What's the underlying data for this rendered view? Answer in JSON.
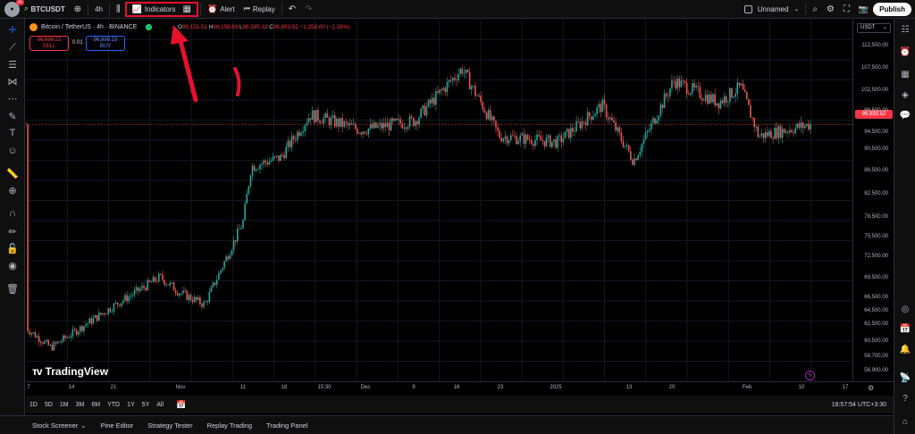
{
  "topbar": {
    "avatar_badge": "11",
    "symbol": "BTCUSDT",
    "interval": "4h",
    "indicators_label": "Indicators",
    "alert_label": "Alert",
    "replay_label": "Replay",
    "layout_name": "Unnamed",
    "publish_label": "Publish"
  },
  "legend": {
    "title": "Bitcoin / TetherUS · 4h · BINANCE",
    "o": "98,151.51",
    "h": "98,158.89",
    "l": "96,595.33",
    "c": "96,893.52",
    "change": "−1,258.00 (−1.28%)",
    "sell_price": "96,899.22",
    "sell_label": "SELL",
    "spread": "0.01",
    "buy_price": "96,899.23",
    "buy_label": "BUY"
  },
  "price_axis": {
    "currency": "USDT",
    "current_price": "96,893.52",
    "labels": [
      "112,500.00",
      "107,500.00",
      "102,500.00",
      "98,500.00",
      "94,500.00",
      "90,500.00",
      "86,500.00",
      "82,500.00",
      "78,500.00",
      "75,500.00",
      "72,500.00",
      "69,500.00",
      "66,500.00",
      "64,500.00",
      "62,500.00",
      "60,500.00",
      "58,700.00",
      "56,900.00"
    ]
  },
  "time_axis": {
    "labels": [
      "7",
      "14",
      "21",
      "Nov",
      "11",
      "18",
      "15:30",
      "Dec",
      "9",
      "16",
      "23",
      "2025",
      "13",
      "20",
      "Feb",
      "10",
      "17"
    ]
  },
  "range_bar": {
    "ranges": [
      "1D",
      "5D",
      "1M",
      "3M",
      "6M",
      "YTD",
      "1Y",
      "5Y",
      "All"
    ],
    "clock": "18:57:54 UTC+3:30"
  },
  "bottom_bar": {
    "items": [
      "Stock Screener",
      "Pine Editor",
      "Strategy Tester",
      "Replay Trading",
      "Trading Panel"
    ]
  },
  "watermark": "TradingView",
  "colors": {
    "up": "#26a69a",
    "down": "#ef5350",
    "highlight": "#e8112d",
    "background": "#000000"
  },
  "chart_data": {
    "type": "candlestick",
    "symbol": "BTCUSDT",
    "interval": "4h",
    "y_range": [
      55000,
      114000
    ],
    "x_labels": [
      "7",
      "14",
      "21",
      "Nov",
      "11",
      "18",
      "15:30",
      "Dec",
      "9",
      "16",
      "23",
      "2025",
      "13",
      "20",
      "Feb",
      "10",
      "17"
    ],
    "current_price": 96893.52,
    "approx_close_path": [
      {
        "x": "7",
        "y": 63500
      },
      {
        "x": "14",
        "y": 60500
      },
      {
        "x": "21",
        "y": 67000
      },
      {
        "x": "Oct 28",
        "y": 72000
      },
      {
        "x": "Nov",
        "y": 69500
      },
      {
        "x": "Nov 5",
        "y": 67500
      },
      {
        "x": "11",
        "y": 81000
      },
      {
        "x": "13",
        "y": 90000
      },
      {
        "x": "18",
        "y": 91500
      },
      {
        "x": "22",
        "y": 98500
      },
      {
        "x": "Dec",
        "y": 96000
      },
      {
        "x": "9",
        "y": 97500
      },
      {
        "x": "16",
        "y": 106000
      },
      {
        "x": "23",
        "y": 95000
      },
      {
        "x": "2025",
        "y": 94000
      },
      {
        "x": "Jan 7",
        "y": 100000
      },
      {
        "x": "13",
        "y": 91000
      },
      {
        "x": "20",
        "y": 104000
      },
      {
        "x": "Jan 27",
        "y": 100500
      },
      {
        "x": "Feb",
        "y": 103000
      },
      {
        "x": "Feb 3",
        "y": 95000
      },
      {
        "x": "10",
        "y": 96900
      }
    ]
  }
}
